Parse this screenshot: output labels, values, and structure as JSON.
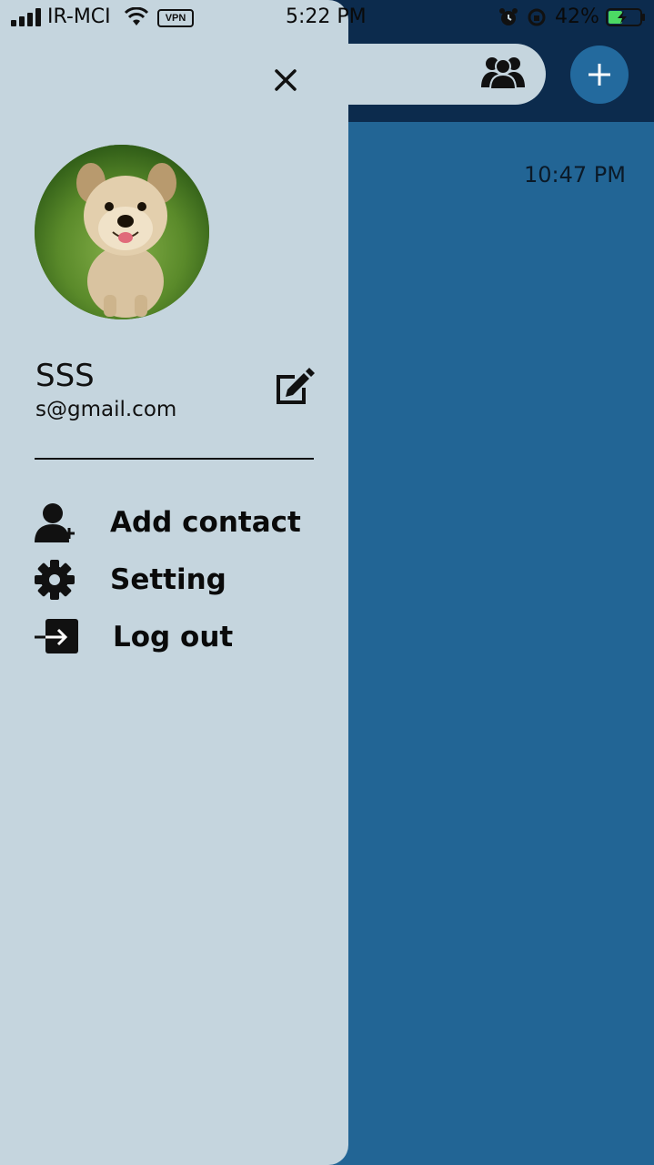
{
  "status_bar": {
    "carrier": "IR-MCI",
    "vpn_label": "VPN",
    "time": "5:22 PM",
    "battery_percent": "42%"
  },
  "main": {
    "chat_time": "10:47 PM"
  },
  "drawer": {
    "user": {
      "name": "SSS",
      "email": "s@gmail.com"
    },
    "menu": [
      {
        "label": "Add contact",
        "icon": "add-contact-icon"
      },
      {
        "label": "Setting",
        "icon": "gear-icon"
      },
      {
        "label": "Log out",
        "icon": "logout-icon"
      }
    ]
  },
  "colors": {
    "drawer_bg": "#c5d5de",
    "main_bg": "#226595",
    "header_bg": "#0c2b4d",
    "fab_bg": "#236a9e"
  }
}
